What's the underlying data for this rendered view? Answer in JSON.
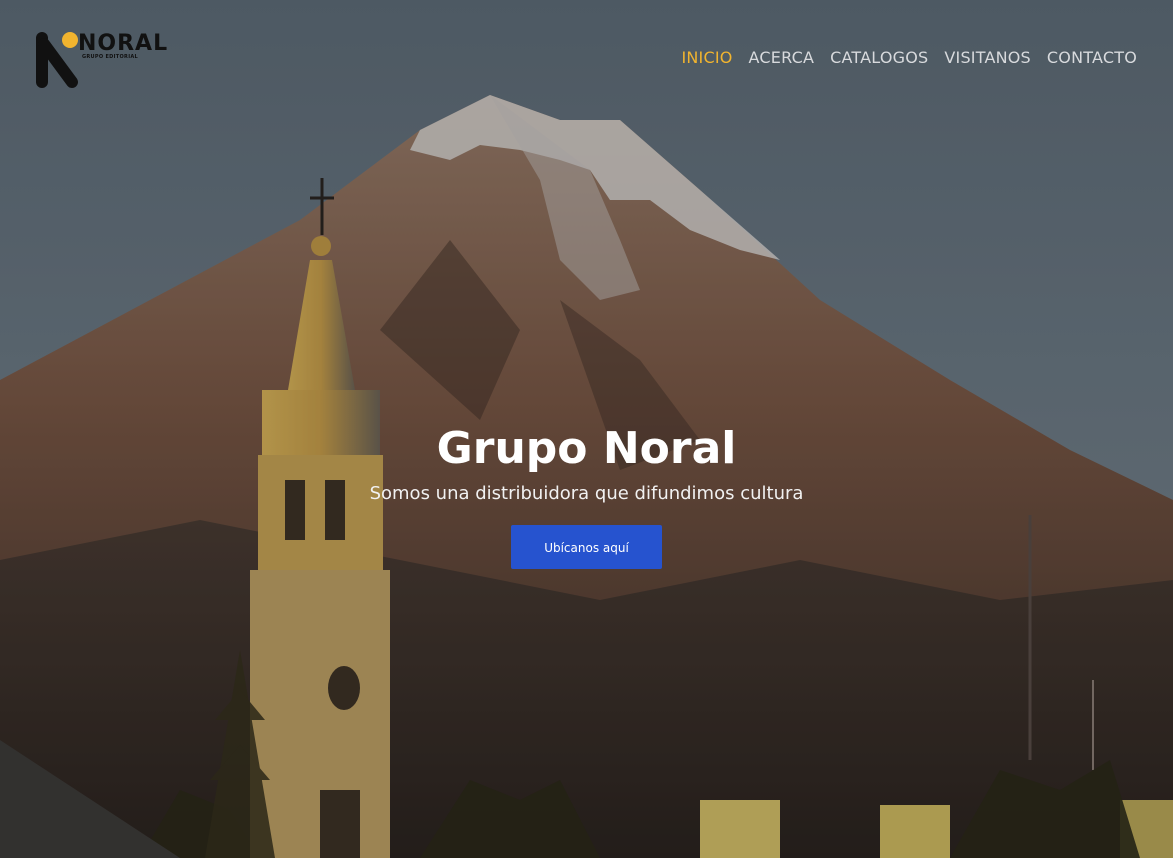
{
  "brand": {
    "logo_word": "NORAL",
    "logo_sub": "GRUPO EDITORIAL",
    "logo_colors": {
      "ink": "#111111",
      "dot": "#f1b42f"
    }
  },
  "nav": {
    "items": [
      {
        "label": "INICIO",
        "active": true
      },
      {
        "label": "ACERCA",
        "active": false
      },
      {
        "label": "CATALOGOS",
        "active": false
      },
      {
        "label": "VISITANOS",
        "active": false
      },
      {
        "label": "CONTACTO",
        "active": false
      }
    ],
    "active_color": "#f1b42f",
    "default_color": "#d8dadd"
  },
  "hero": {
    "title": "Grupo Noral",
    "subtitle": "Somos una distribuidora que difundimos cultura",
    "cta_label": "Ubícanos aquí",
    "cta_color": "#2653cf",
    "background_description_icon": "volcano-cathedral-photo"
  }
}
